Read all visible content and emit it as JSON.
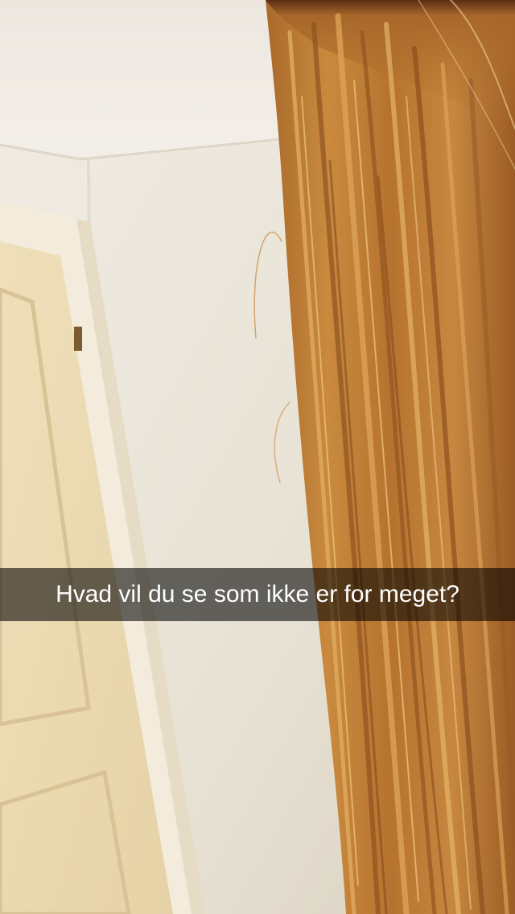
{
  "snap": {
    "caption": "Hvad vil du se som ikke er for meget?"
  },
  "colors": {
    "wall": "#ece7dc",
    "ceiling": "#f0ece4",
    "door": "#ecdcb6",
    "door_frame": "#f2ead8",
    "hair_dark": "#8a4f22",
    "hair_mid": "#b8772e",
    "hair_light": "#d8a058",
    "caption_bar": "rgba(0,0,0,0.58)",
    "caption_text": "#ffffff"
  }
}
